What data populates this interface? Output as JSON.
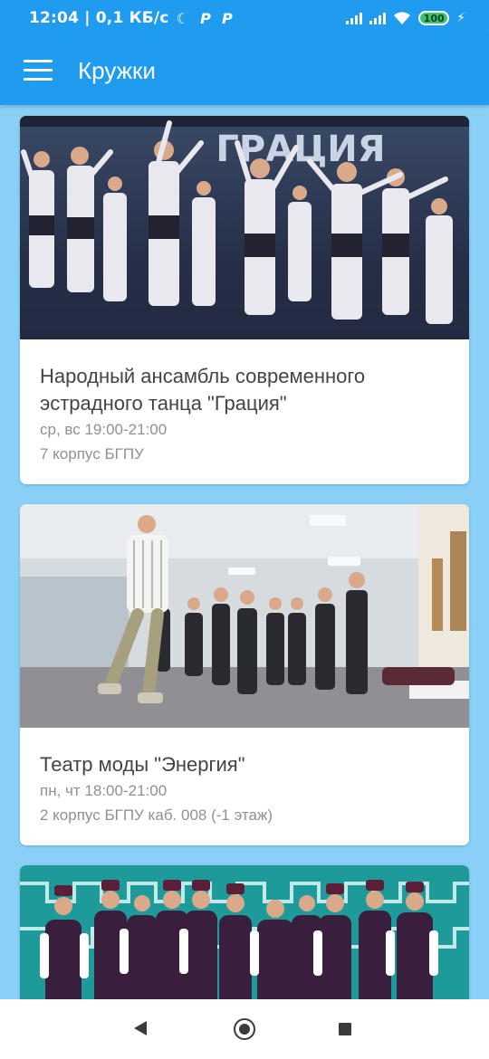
{
  "status_bar": {
    "time": "12:04",
    "speed": "0,1 КБ/с",
    "moon_glyph": "☾",
    "app_icon_1": "P",
    "app_icon_2": "P",
    "battery": "100",
    "icons": [
      "moon-icon",
      "p-app-icon",
      "p-app-icon",
      "signal-icon",
      "signal-icon",
      "wifi-icon",
      "battery-icon",
      "charging-icon"
    ]
  },
  "app_bar": {
    "title": "Кружки",
    "background_color": "#1f9cef",
    "menu_icon": "hamburger-menu-icon"
  },
  "page": {
    "background_color": "#8ad0f6"
  },
  "cards": [
    {
      "title": "Народный ансамбль современного эстрадного танца \"Грация\"",
      "schedule": "ср, вс 19:00-21:00",
      "location": "7 корпус БГПУ",
      "image": "dance ensemble performing on stage",
      "image_banner_text": "ГРАЦИЯ"
    },
    {
      "title": "Театр моды \"Энергия\"",
      "schedule": "пн, чт  18:00-21:00",
      "location": "2 корпус БГПУ каб. 008 (-1 этаж)",
      "image": "fashion theatre rehearsal in hall"
    },
    {
      "image": "folk ensemble in traditional costumes"
    }
  ],
  "nav_bar": {
    "icons": [
      "back-icon",
      "home-icon",
      "recents-icon"
    ]
  }
}
